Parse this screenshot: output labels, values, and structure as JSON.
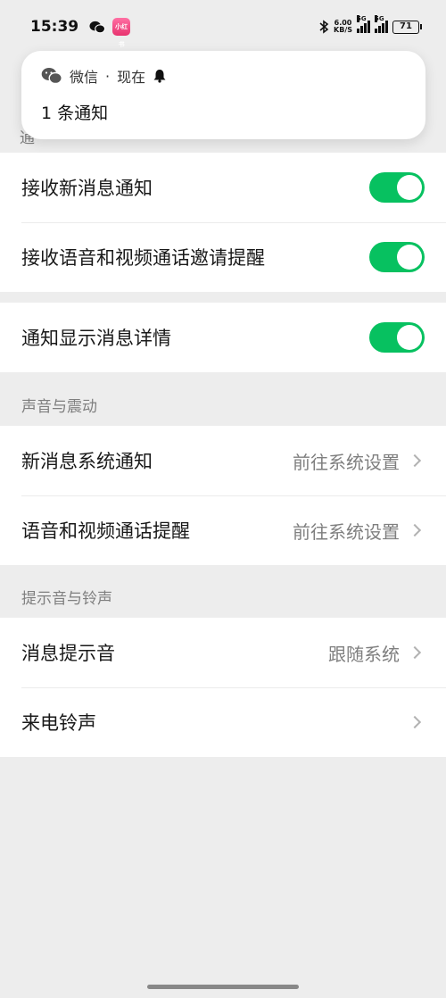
{
  "status_bar": {
    "time": "15:39",
    "app_icon_text": "小红书",
    "network_speed": "6.00",
    "network_unit": "KB/S",
    "signal1_label": "5G",
    "signal2_label": "5G",
    "battery": "71"
  },
  "notification": {
    "app_name": "微信",
    "separator": "·",
    "time": "现在",
    "body": "1 条通知"
  },
  "partial_header": "通",
  "group1": {
    "rows": [
      {
        "label": "接收新消息通知",
        "on": true
      },
      {
        "label": "接收语音和视频通话邀请提醒",
        "on": true
      }
    ]
  },
  "group2": {
    "rows": [
      {
        "label": "通知显示消息详情",
        "on": true
      }
    ]
  },
  "sound_section": {
    "title": "声音与震动",
    "rows": [
      {
        "label": "新消息系统通知",
        "value": "前往系统设置"
      },
      {
        "label": "语音和视频通话提醒",
        "value": "前往系统设置"
      }
    ]
  },
  "ringtone_section": {
    "title": "提示音与铃声",
    "rows": [
      {
        "label": "消息提示音",
        "value": "跟随系统"
      },
      {
        "label": "来电铃声",
        "value": ""
      }
    ]
  },
  "colors": {
    "toggle_on": "#07c160",
    "background": "#ededed",
    "secondary_text": "#7f7f7f"
  },
  "icons": [
    "wechat-icon",
    "bell-icon",
    "bluetooth-icon",
    "signal-icon",
    "battery-icon",
    "chevron-right-icon"
  ]
}
